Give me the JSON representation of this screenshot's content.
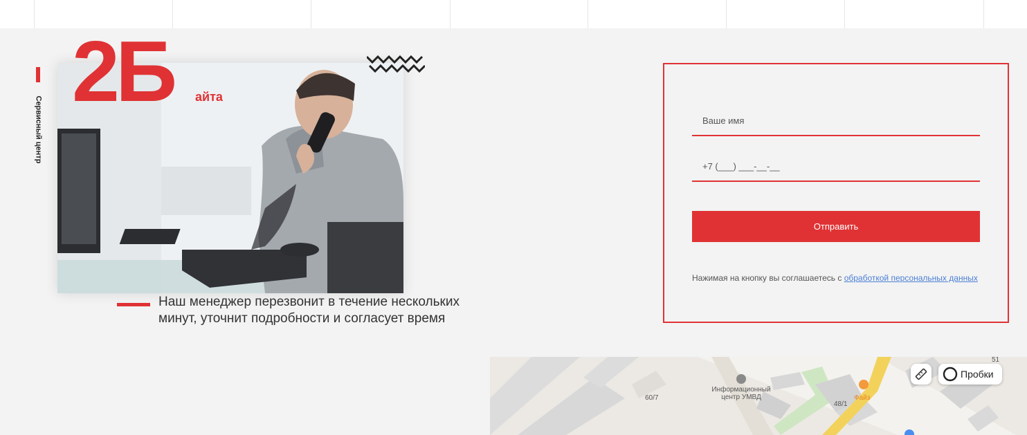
{
  "side_label": "Сервисный центр",
  "hero": {
    "big_number": "2Б",
    "suffix": "айта"
  },
  "description": "Наш менеджер перезвонит в течение нескольких минут, уточнит подробности и согласует время",
  "form": {
    "name_placeholder": "Ваше имя",
    "phone_placeholder": "+7 (___) ___-__-__",
    "submit_label": "Отправить",
    "consent_text": "Нажимая на кнопку вы соглашаетесь с ",
    "consent_link": "обработкой персональных данных"
  },
  "map": {
    "labels": {
      "info_center": "Информационный центр УМВД",
      "building_60_7": "60/7",
      "building_48_1": "48/1",
      "poi_fayz": "Файз",
      "building_51": "51"
    },
    "ruler_icon": "ruler-icon",
    "traffic_label": "Пробки"
  },
  "colors": {
    "accent": "#e03234",
    "link": "#4a7fd6",
    "background": "#f3f3f3"
  }
}
